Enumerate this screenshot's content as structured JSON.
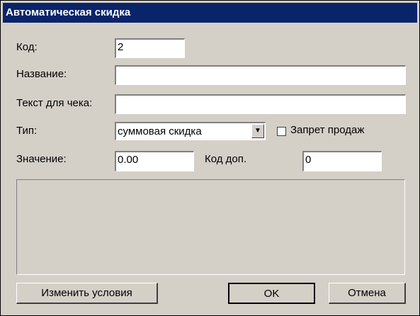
{
  "window": {
    "title": "Автоматическая скидка"
  },
  "form": {
    "code_label": "Код:",
    "code_value": "2",
    "name_label": "Название:",
    "name_value": "",
    "receipt_label": "Текст для чека:",
    "receipt_value": "",
    "type_label": "Тип:",
    "type_value": "суммовая скидка",
    "sale_ban_label": "Запрет продаж",
    "sale_ban_checked": false,
    "value_label": "Значение:",
    "value_value": "0.00",
    "extra_code_label": "Код доп.",
    "extra_code_value": "0"
  },
  "buttons": {
    "change_conditions": "Изменить условия",
    "ok": "OK",
    "cancel": "Отмена"
  },
  "icons": {
    "dropdown": "chevron-down-icon"
  }
}
